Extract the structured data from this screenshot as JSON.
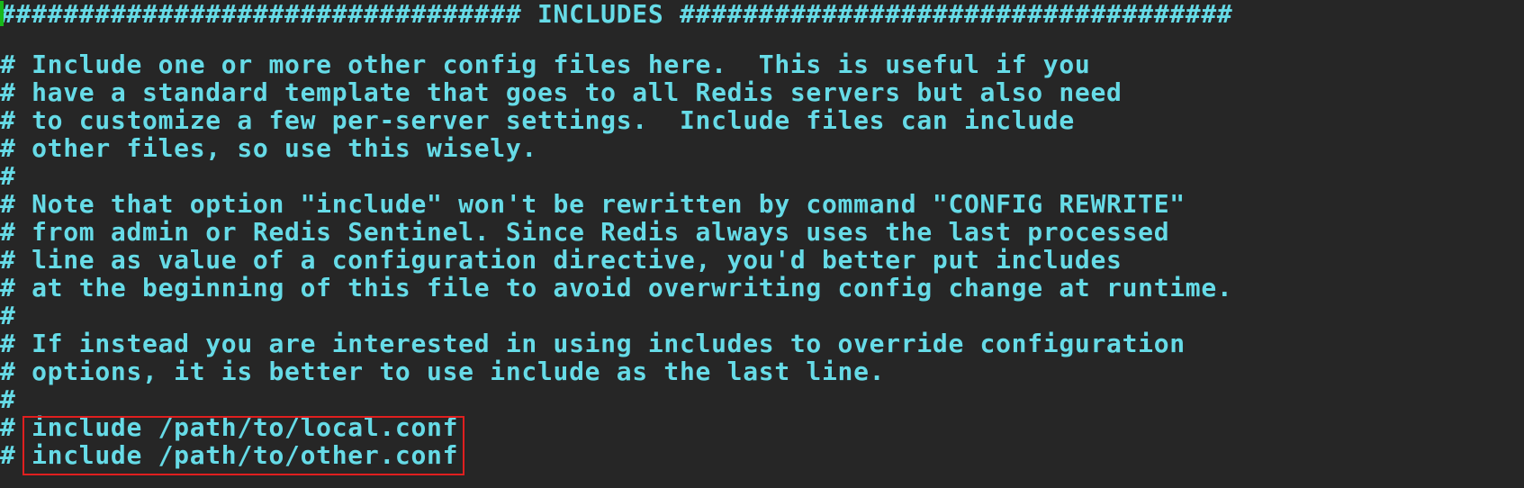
{
  "editor": {
    "lines": [
      "################################# INCLUDES ###################################",
      "",
      "# Include one or more other config files here.  This is useful if you",
      "# have a standard template that goes to all Redis servers but also need",
      "# to customize a few per-server settings.  Include files can include",
      "# other files, so use this wisely.",
      "#",
      "# Note that option \"include\" won't be rewritten by command \"CONFIG REWRITE\"",
      "# from admin or Redis Sentinel. Since Redis always uses the last processed",
      "# line as value of a configuration directive, you'd better put includes",
      "# at the beginning of this file to avoid overwriting config change at runtime.",
      "#",
      "# If instead you are interested in using includes to override configuration",
      "# options, it is better to use include as the last line.",
      "#",
      "# include /path/to/local.conf",
      "# include /path/to/other.conf"
    ]
  },
  "colors": {
    "background": "#262626",
    "text": "#66dbe7",
    "cursor": "#18b81a",
    "highlight_border": "#e01f1f"
  }
}
